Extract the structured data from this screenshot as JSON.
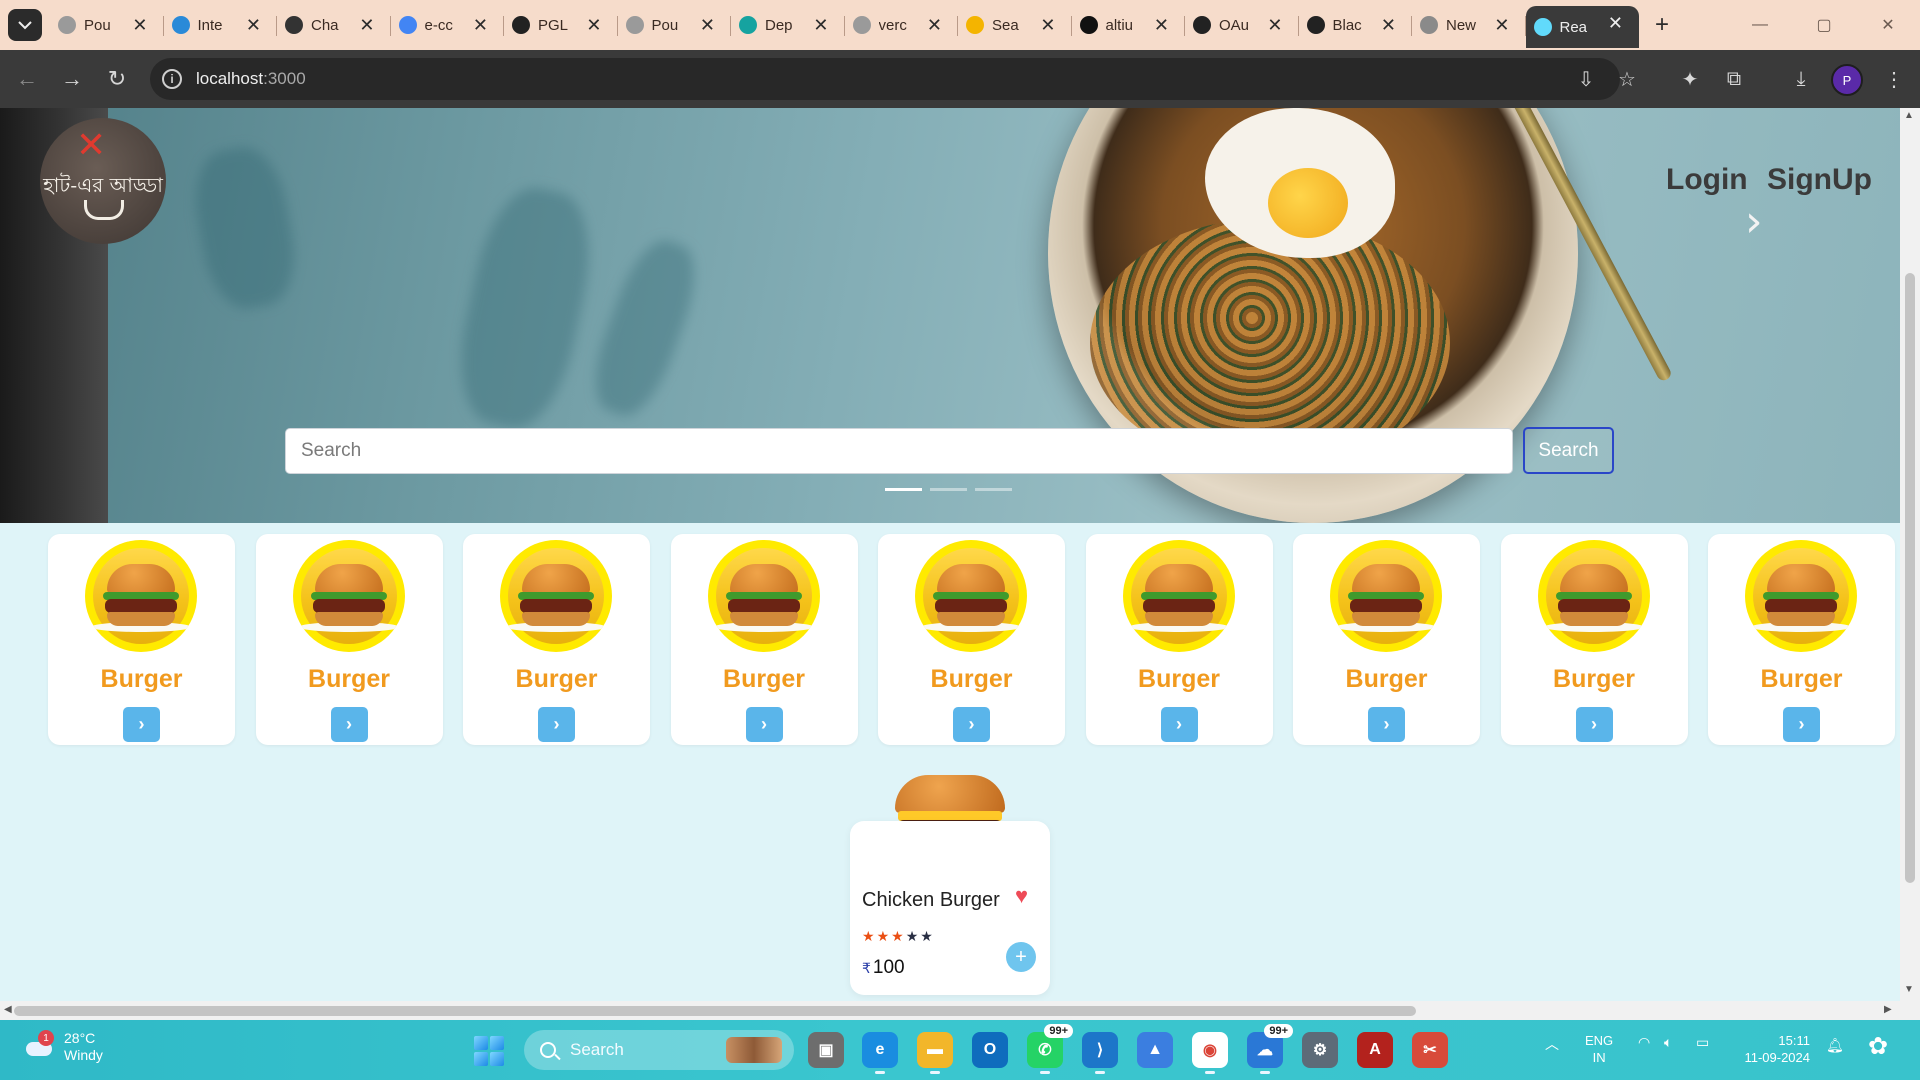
{
  "browser": {
    "tabs": [
      {
        "title": "Pou",
        "favicon": "globe-icon",
        "color": "#9a9a9a"
      },
      {
        "title": "Inte",
        "favicon": "ist-icon",
        "color": "#2a8ad8"
      },
      {
        "title": "Cha",
        "favicon": "chatgpt-icon",
        "color": "#333333"
      },
      {
        "title": "e-cc",
        "favicon": "google-icon",
        "color": "#4285f4"
      },
      {
        "title": "PGL",
        "favicon": "github-icon",
        "color": "#222222"
      },
      {
        "title": "Pou",
        "favicon": "globe-icon",
        "color": "#9a9a9a"
      },
      {
        "title": "Dep",
        "favicon": "diamond-icon",
        "color": "#16a3a0"
      },
      {
        "title": "verc",
        "favicon": "globe-icon",
        "color": "#9a9a9a"
      },
      {
        "title": "Sea",
        "favicon": "drive-icon",
        "color": "#f4b400"
      },
      {
        "title": "altiu",
        "favicon": "triangle-icon",
        "color": "#111111"
      },
      {
        "title": "OAu",
        "favicon": "github-icon",
        "color": "#222222"
      },
      {
        "title": "Blac",
        "favicon": "bolt-icon",
        "color": "#222222"
      },
      {
        "title": "New",
        "favicon": "chrome-icon",
        "color": "#8a8a8a"
      },
      {
        "title": "Rea",
        "favicon": "react-icon",
        "color": "#61dafb",
        "active": true
      }
    ],
    "url_host": "localhost",
    "url_port": ":3000",
    "profile_initial": "P"
  },
  "header": {
    "login_label": "Login",
    "signup_label": "SignUp",
    "logo_text": "হাট-এর আড্ডা"
  },
  "hero": {
    "search_placeholder": "Search",
    "search_button": "Search",
    "slides": 3,
    "active_slide": 0
  },
  "categories": [
    {
      "label": "Burger"
    },
    {
      "label": "Burger"
    },
    {
      "label": "Burger"
    },
    {
      "label": "Burger"
    },
    {
      "label": "Burger"
    },
    {
      "label": "Burger"
    },
    {
      "label": "Burger"
    },
    {
      "label": "Burger"
    },
    {
      "label": "Burger"
    }
  ],
  "product": {
    "name": "Chicken Burger",
    "rating": 3,
    "rating_max": 5,
    "currency": "₹",
    "price": "100"
  },
  "taskbar": {
    "weather_temp": "28°C",
    "weather_desc": "Windy",
    "weather_badge": "1",
    "search_label": "Search",
    "whatsapp_badge": "99+",
    "outlook_badge": "99+",
    "lang_top": "ENG",
    "lang_bottom": "IN",
    "time": "15:11",
    "date": "11-09-2024"
  },
  "colors": {
    "category_label": "#f19a1e",
    "accent_blue": "#5ab5ea",
    "heart": "#ee4b57",
    "star": "#ea4f14"
  }
}
